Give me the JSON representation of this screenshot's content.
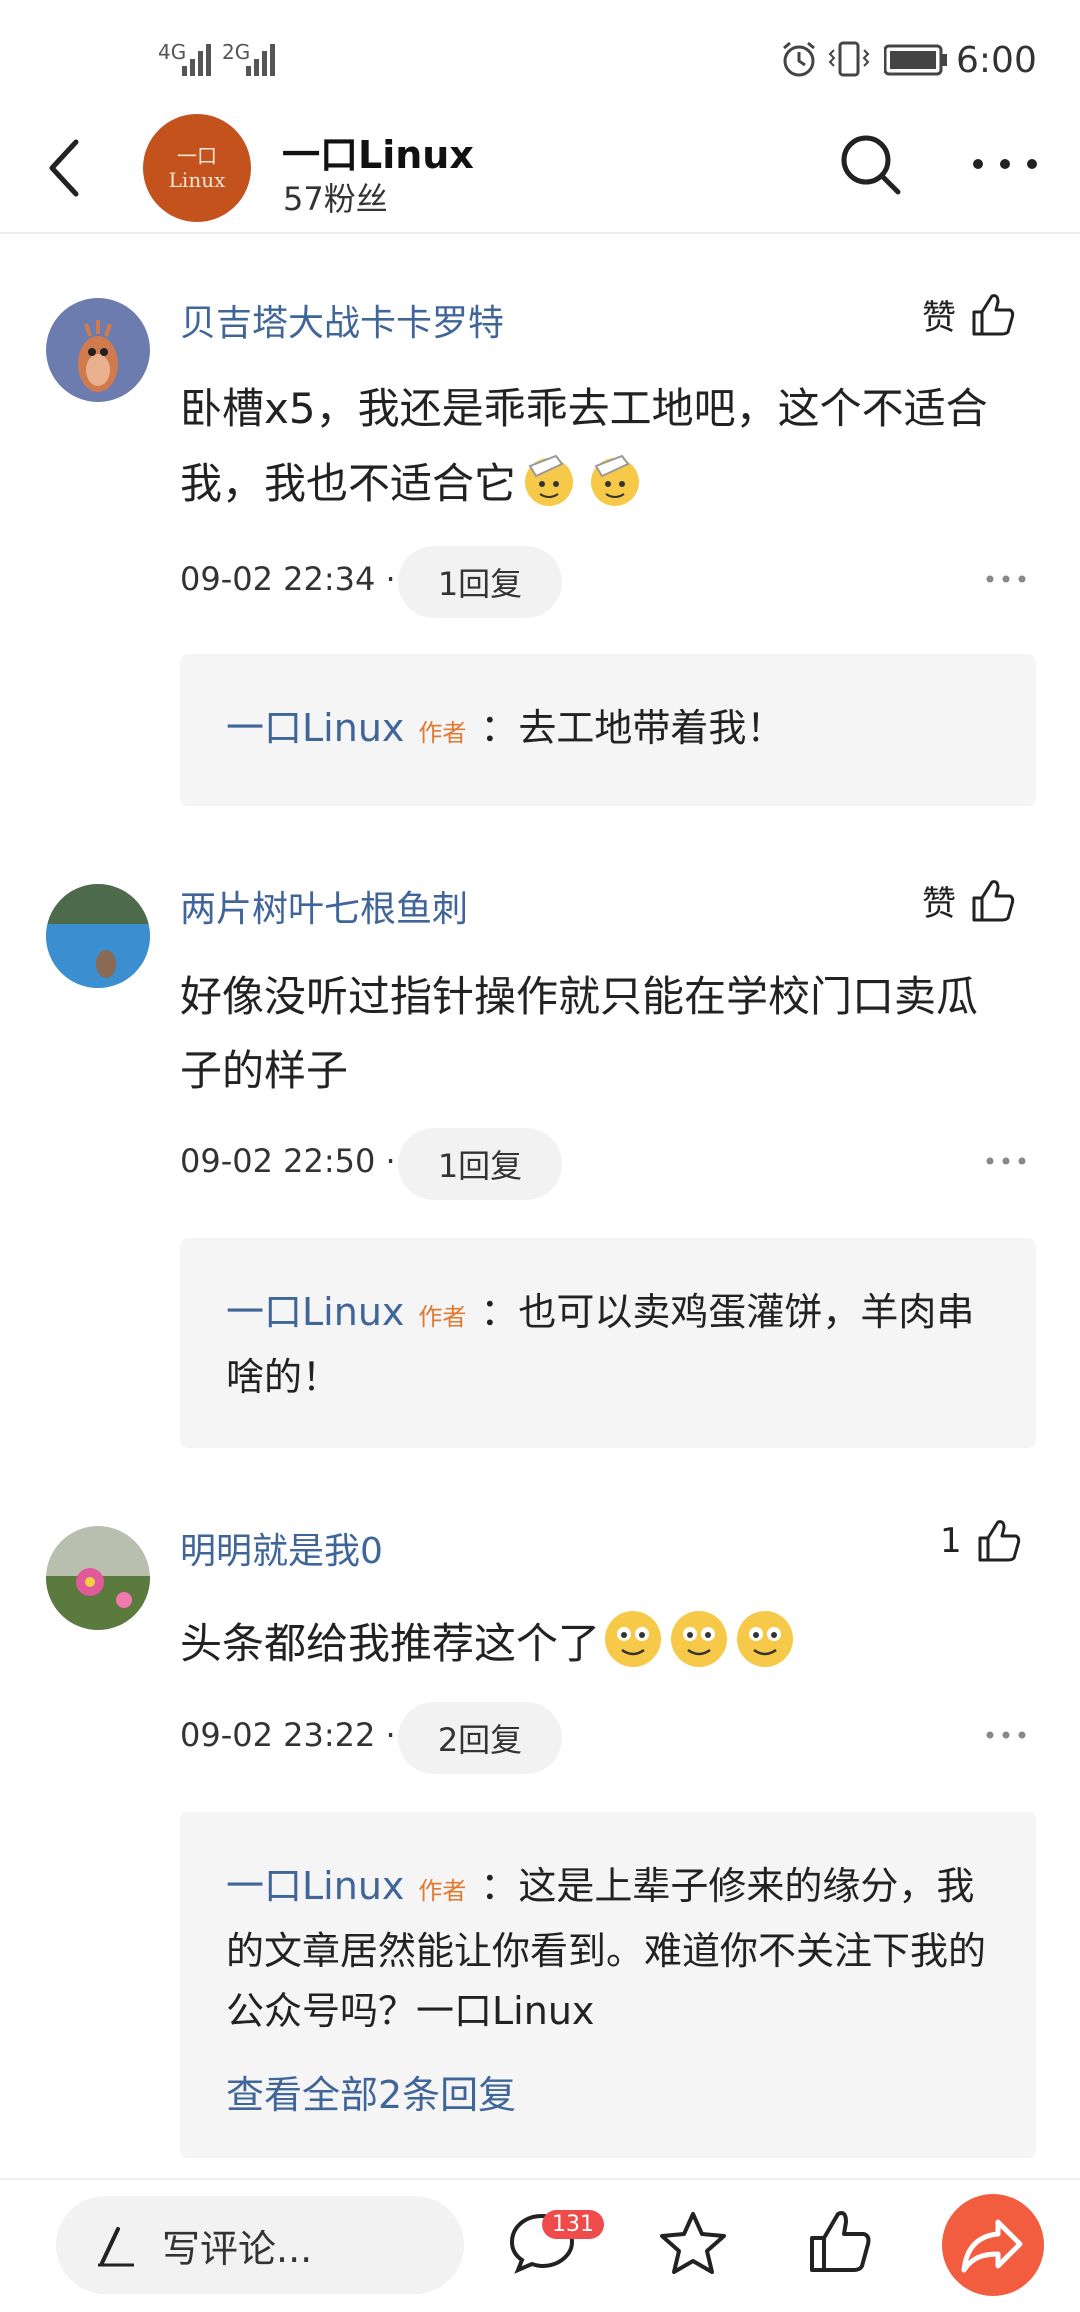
{
  "status_bar": {
    "signal1": "4G",
    "signal2": "2G",
    "time": "6:00"
  },
  "header": {
    "logo_text_line1": "一口",
    "logo_text_line2": "Linux",
    "title": "一口Linux",
    "followers": "57粉丝"
  },
  "comments": [
    {
      "user": "贝吉塔大战卡卡罗特",
      "like_label": "赞",
      "text": "卧槽x5，我还是乖乖去工地吧，这个不适合我，我也不适合它",
      "emojis": [
        "salute-emoji",
        "salute-emoji"
      ],
      "time": "09-02 22:34",
      "dot": "·",
      "reply_count": "1回复",
      "reply": {
        "name": "一口Linux",
        "badge": "作者",
        "text": "：去工地带着我！"
      }
    },
    {
      "user": "两片树叶七根鱼刺",
      "like_label": "赞",
      "text": "好像没听过指针操作就只能在学校门口卖瓜子的样子",
      "time": "09-02 22:50",
      "dot": "·",
      "reply_count": "1回复",
      "reply": {
        "name": "一口Linux",
        "badge": "作者",
        "text": "：也可以卖鸡蛋灌饼，羊肉串啥的！"
      }
    },
    {
      "user": "明明就是我0",
      "like_label": "1",
      "text": "头条都给我推荐这个了",
      "emojis": [
        "smile-emoji",
        "smile-emoji",
        "smile-emoji"
      ],
      "time": "09-02 23:22",
      "dot": "·",
      "reply_count": "2回复",
      "reply": {
        "name": "一口Linux",
        "badge": "作者",
        "text": "：这是上辈子修来的缘分，我的文章居然能让你看到。难道你不关注下我的公众号吗？一口Linux"
      },
      "view_all": "查看全部2条回复"
    }
  ],
  "bottom_bar": {
    "input_placeholder": "写评论...",
    "comment_count": "131"
  },
  "colors": {
    "brand": "#c4521c",
    "username": "#406599",
    "author_badge": "#e07a30",
    "share": "#f25c3f",
    "badge": "#f04b4b"
  }
}
